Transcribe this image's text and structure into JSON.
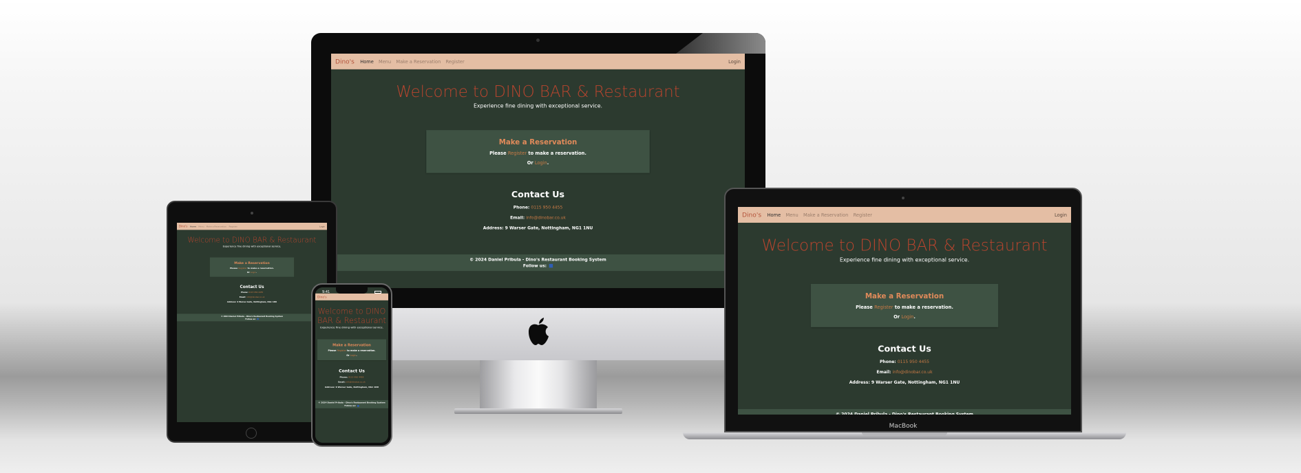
{
  "site": {
    "brand": "Dino's",
    "nav": {
      "home": "Home",
      "menu": "Menu",
      "reservation": "Make a Reservation",
      "register": "Register",
      "login": "Login"
    },
    "hero": {
      "title": "Welcome to DINO BAR & Restaurant",
      "subtitle": "Experience fine dining with exceptional service."
    },
    "reservation": {
      "title": "Make a Reservation",
      "please": "Please",
      "register_link": "Register",
      "please_suffix": "to make a reservation.",
      "or": "Or",
      "login_link": "Login",
      "login_suffix": "."
    },
    "contact": {
      "title": "Contact Us",
      "phone_label": "Phone:",
      "phone": "0115 950 4455",
      "email_label": "Email:",
      "email": "info@dinobar.co.uk",
      "address_label": "Address:",
      "address": "9 Warser Gate, Nottingham, NG1 1NU"
    },
    "footer": {
      "copyright": "© 2024 Daniel Pribula - Dino's Restaurant Booking System",
      "follow": "Follow us:",
      "facebook_icon": "facebook-icon"
    }
  },
  "devices": {
    "laptop_label": "MacBook",
    "phone_time": "9:41"
  }
}
